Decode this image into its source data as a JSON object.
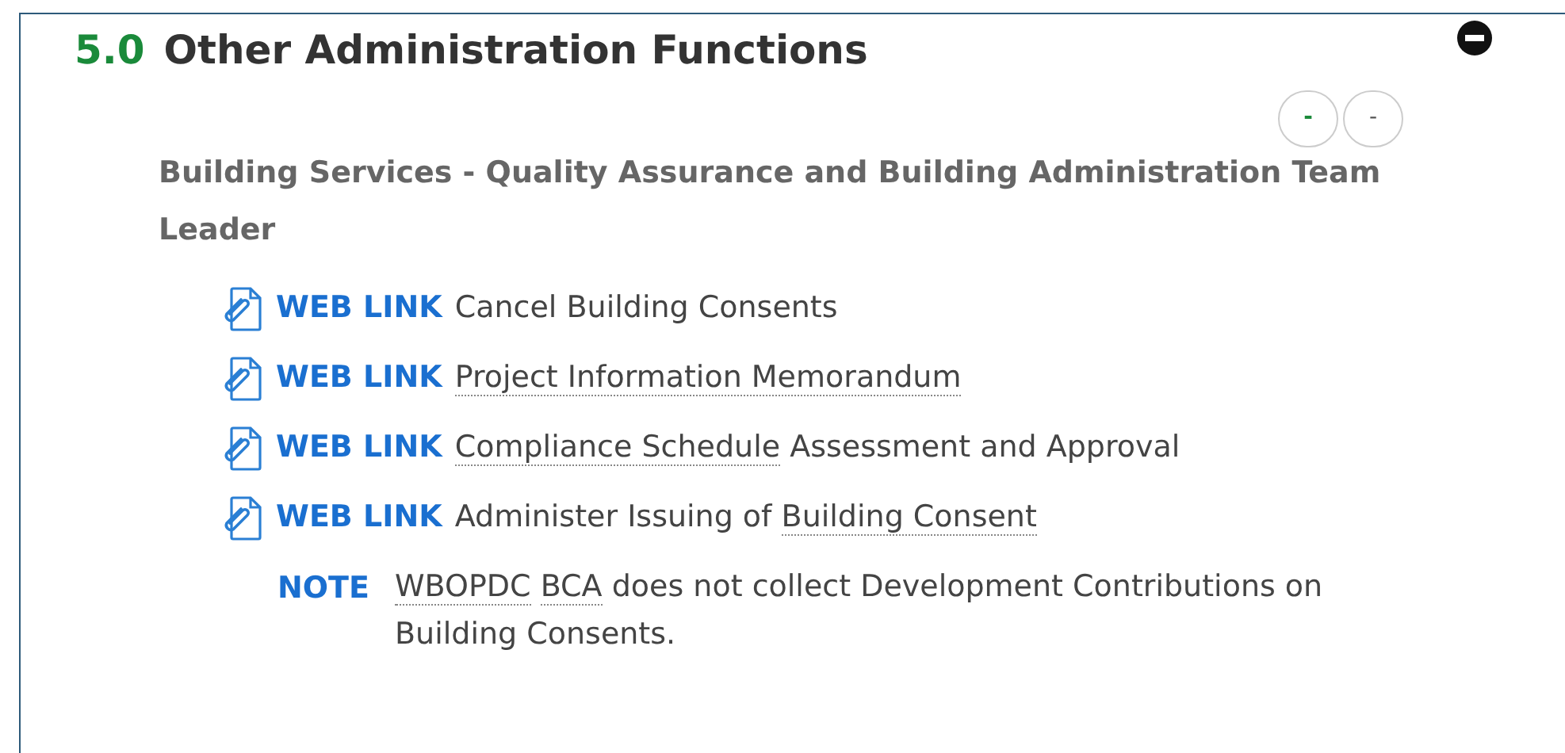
{
  "section": {
    "number": "5.0",
    "title": "Other Administration Functions"
  },
  "buttons": [
    {
      "label": "-",
      "selected": true
    },
    {
      "label": "-",
      "selected": false
    }
  ],
  "subheading": "Building Services - Quality Assurance and Building Administration Team Leader",
  "items": [
    {
      "kind": "link",
      "tag": "WEB LINK",
      "parts": [
        {
          "text": "Cancel Building Consents",
          "term": false
        }
      ]
    },
    {
      "kind": "link",
      "tag": "WEB LINK",
      "parts": [
        {
          "text": "Project Information Memorandum",
          "term": true
        }
      ]
    },
    {
      "kind": "link",
      "tag": "WEB LINK",
      "parts": [
        {
          "text": "Compliance Schedule",
          "term": true
        },
        {
          "text": "Assessment and Approval",
          "term": false
        }
      ]
    },
    {
      "kind": "link",
      "tag": "WEB LINK",
      "parts": [
        {
          "text": "Administer Issuing of",
          "term": false
        },
        {
          "text": "Building Consent",
          "term": true
        }
      ]
    },
    {
      "kind": "note",
      "tag": "NOTE",
      "parts": [
        {
          "text": "WBOPDC",
          "term": true
        },
        {
          "text": "BCA",
          "term": true
        },
        {
          "text": "does not collect Development Contributions on Building Consents.",
          "term": false
        }
      ]
    }
  ]
}
